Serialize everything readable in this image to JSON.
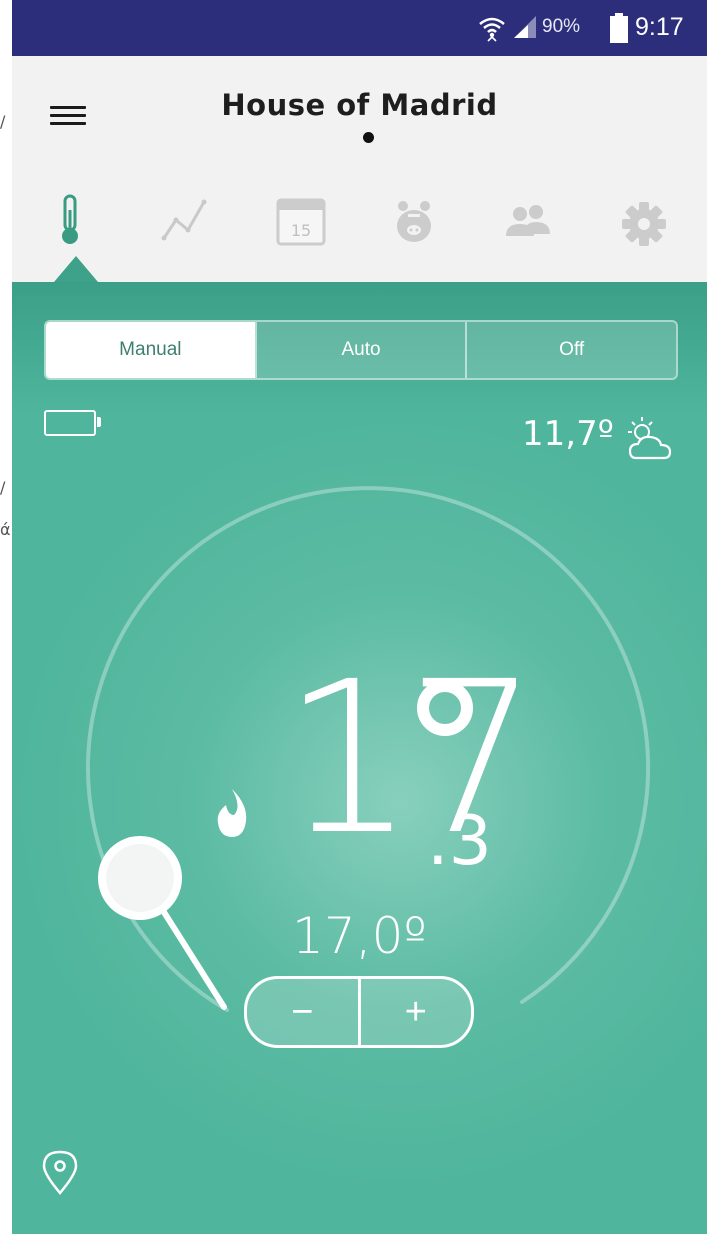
{
  "gutter_chars": [
    "/",
    "/",
    "ά"
  ],
  "status_bar": {
    "battery_percent": "90%",
    "time": "9:17",
    "icons": [
      "wifi-icon",
      "signal-icon",
      "battery-icon"
    ]
  },
  "header": {
    "title": "House of Madrid"
  },
  "tabs": [
    {
      "name": "thermometer",
      "icon": "thermometer-icon",
      "active": true
    },
    {
      "name": "chart",
      "icon": "chart-icon"
    },
    {
      "name": "calendar",
      "icon": "calendar-icon",
      "label": "15"
    },
    {
      "name": "piggy-bank",
      "icon": "piggy-bank-icon"
    },
    {
      "name": "users",
      "icon": "users-icon"
    },
    {
      "name": "settings",
      "icon": "gear-icon"
    }
  ],
  "mode": {
    "options": [
      "Manual",
      "Auto",
      "Off"
    ],
    "selected": "Manual"
  },
  "weather": {
    "temp": "11,7º",
    "icon": "partly-cloudy-icon"
  },
  "thermostat": {
    "temp_int": "17",
    "temp_decimal": ".3",
    "setpoint": "17,0º",
    "heating_icon": "flame-icon",
    "decrease_label": "−",
    "increase_label": "+",
    "dial_level": 0.1
  },
  "colors": {
    "status_bar": "#2c2e7c",
    "accent": "#4fb59c",
    "header_bg": "#f2f2f2"
  }
}
